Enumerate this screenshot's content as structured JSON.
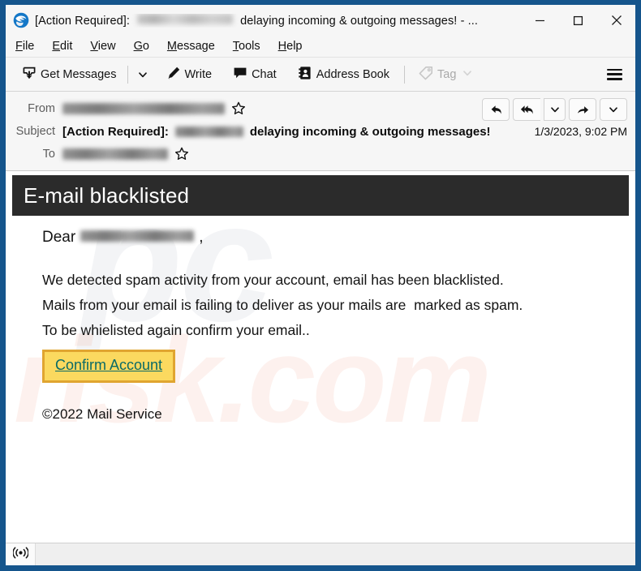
{
  "window": {
    "title_prefix": "[Action Required]:",
    "title_suffix": "delaying incoming & outgoing messages! - ...",
    "app_icon": "thunderbird-icon",
    "controls": {
      "minimize": "minimize-icon",
      "maximize": "maximize-icon",
      "close": "close-icon"
    }
  },
  "menubar": {
    "items": [
      {
        "pre": "",
        "key": "F",
        "post": "ile"
      },
      {
        "pre": "",
        "key": "E",
        "post": "dit"
      },
      {
        "pre": "",
        "key": "V",
        "post": "iew"
      },
      {
        "pre": "",
        "key": "G",
        "post": "o"
      },
      {
        "pre": "",
        "key": "M",
        "post": "essage"
      },
      {
        "pre": "",
        "key": "T",
        "post": "ools"
      },
      {
        "pre": "",
        "key": "H",
        "post": "elp"
      }
    ]
  },
  "toolbar": {
    "get_messages": "Get Messages",
    "write": "Write",
    "chat": "Chat",
    "address_book": "Address Book",
    "tag": "Tag",
    "tag_disabled": true,
    "app_menu": "app-menu-button"
  },
  "message_header": {
    "from_label": "From",
    "from_value_redacted": true,
    "subject_label": "Subject",
    "subject_bold": "[Action Required]:",
    "subject_redacted": true,
    "subject_rest": "delaying incoming & outgoing messages!",
    "to_label": "To",
    "to_value_redacted": true,
    "date": "1/3/2023, 9:02 PM",
    "actions": {
      "reply": "reply-icon",
      "reply_all": "reply-all-icon",
      "reply_menu": "chevron-down-icon",
      "forward": "forward-icon",
      "forward_menu": "chevron-down-icon"
    }
  },
  "email_body": {
    "banner_title": "E-mail blacklisted",
    "banner_bg": "#2b2b2b",
    "greeting_prefix": "Dear",
    "greeting_redacted": true,
    "greeting_suffix": ",",
    "paragraphs": [
      "We detected spam activity from your account, email has been blacklisted.",
      "Mails from your email is failing to deliver as your mails are  marked as spam.",
      "To be whielisted again confirm your email.."
    ],
    "cta_label": "Confirm Account",
    "cta_bg": "#fbd95f",
    "cta_border": "#e0a530",
    "cta_text_color": "#0b6b66",
    "footer": "©2022 Mail Service",
    "watermark_1": "pc",
    "watermark_2": "risk.com"
  },
  "statusbar": {
    "icon": "broadcast-icon",
    "text": ""
  }
}
